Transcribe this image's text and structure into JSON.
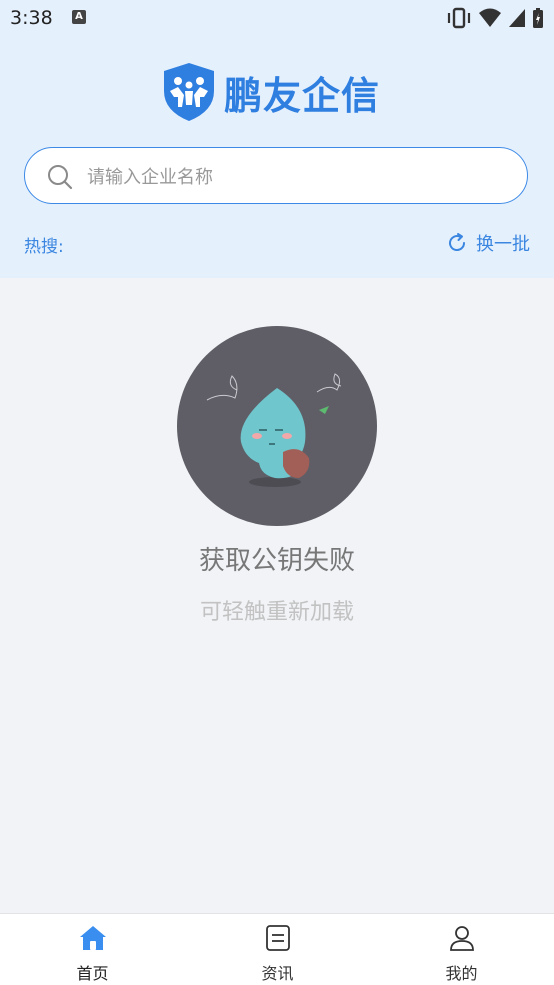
{
  "status_bar": {
    "time": "3:38",
    "notification_icon": "a-letter-icon"
  },
  "app": {
    "logo_text": "鹏友企信",
    "logo_icon": "shield-people-icon"
  },
  "search": {
    "placeholder": "请输入企业名称",
    "value": ""
  },
  "hot": {
    "label": "热搜:",
    "refresh_label": "换一批"
  },
  "empty_state": {
    "title": "获取公钥失败",
    "subtitle": "可轻触重新加载"
  },
  "tabs": [
    {
      "label": "首页",
      "icon": "home-icon",
      "active": true
    },
    {
      "label": "资讯",
      "icon": "news-icon",
      "active": false
    },
    {
      "label": "我的",
      "icon": "user-icon",
      "active": false
    }
  ],
  "colors": {
    "accent": "#2f7fe0",
    "header_bg": "#e5f0fd",
    "page_bg": "#f1f3f7"
  }
}
